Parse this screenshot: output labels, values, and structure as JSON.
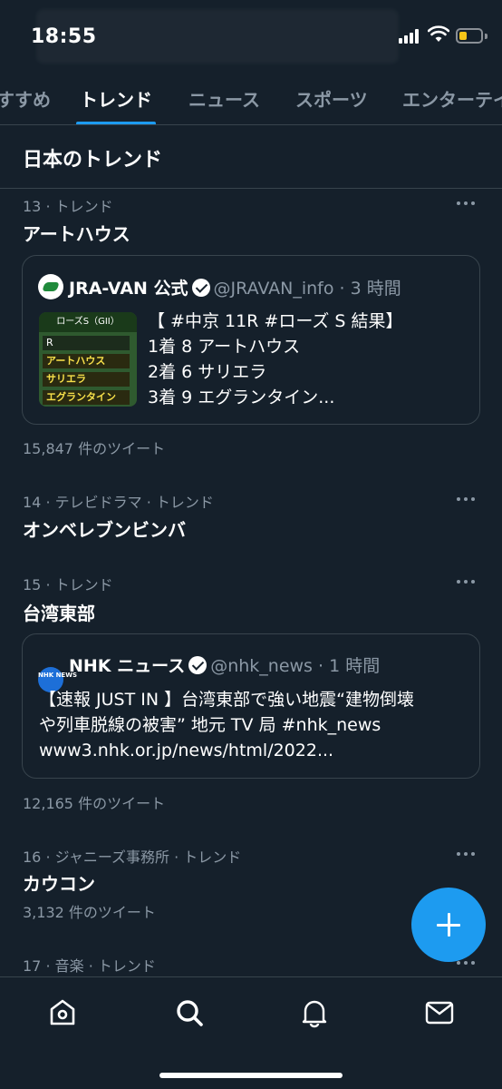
{
  "status": {
    "time": "18:55"
  },
  "tabs": [
    {
      "label": "すすめ"
    },
    {
      "label": "トレンド"
    },
    {
      "label": "ニュース"
    },
    {
      "label": "スポーツ"
    },
    {
      "label": "エンターテイ"
    }
  ],
  "section_title": "日本のトレンド",
  "trends": [
    {
      "meta": "13 · トレンド",
      "name": "アートハウス",
      "count": "15,847 件のツイート",
      "card": {
        "author": "JRA-VAN 公式",
        "handle": "@JRAVAN_info · 3 時間",
        "lines": [
          "【 #中京 11R #ローズ S 結果】",
          "1着 8 アートハウス",
          "2着 6 サリエラ",
          "3着 9 エグランタイン..."
        ],
        "thumb": {
          "title": "ローズS（GII）",
          "row0": "R",
          "row1": "アートハウス",
          "row2": "サリエラ",
          "row3": "エグランタイン"
        }
      }
    },
    {
      "meta": "14 · テレビドラマ · トレンド",
      "name": "オンベレブンビンバ"
    },
    {
      "meta": "15 · トレンド",
      "name": "台湾東部",
      "count": "12,165 件のツイート",
      "card": {
        "author": "NHK ニュース",
        "handle": "@nhk_news · 1 時間",
        "lines": [
          "【速報 JUST IN 】台湾東部で強い地震“建物倒壊",
          "や列車脱線の被害” 地元 TV 局 #nhk_news",
          "www3.nhk.or.jp/news/html/2022..."
        ],
        "logo_text": "NHK NEWS"
      }
    },
    {
      "meta": "16 · ジャニーズ事務所 · トレンド",
      "name": "カウコン",
      "count": "3,132 件のツイート"
    },
    {
      "meta": "17 · 音楽 · トレンド"
    }
  ],
  "icons": {
    "nav": [
      "home-icon",
      "search-icon",
      "bell-icon",
      "mail-icon"
    ],
    "fab": "compose-plus-icon"
  },
  "colors": {
    "accent": "#1d9bf0",
    "background": "#15202b",
    "secondary_text": "#8b98a5"
  }
}
